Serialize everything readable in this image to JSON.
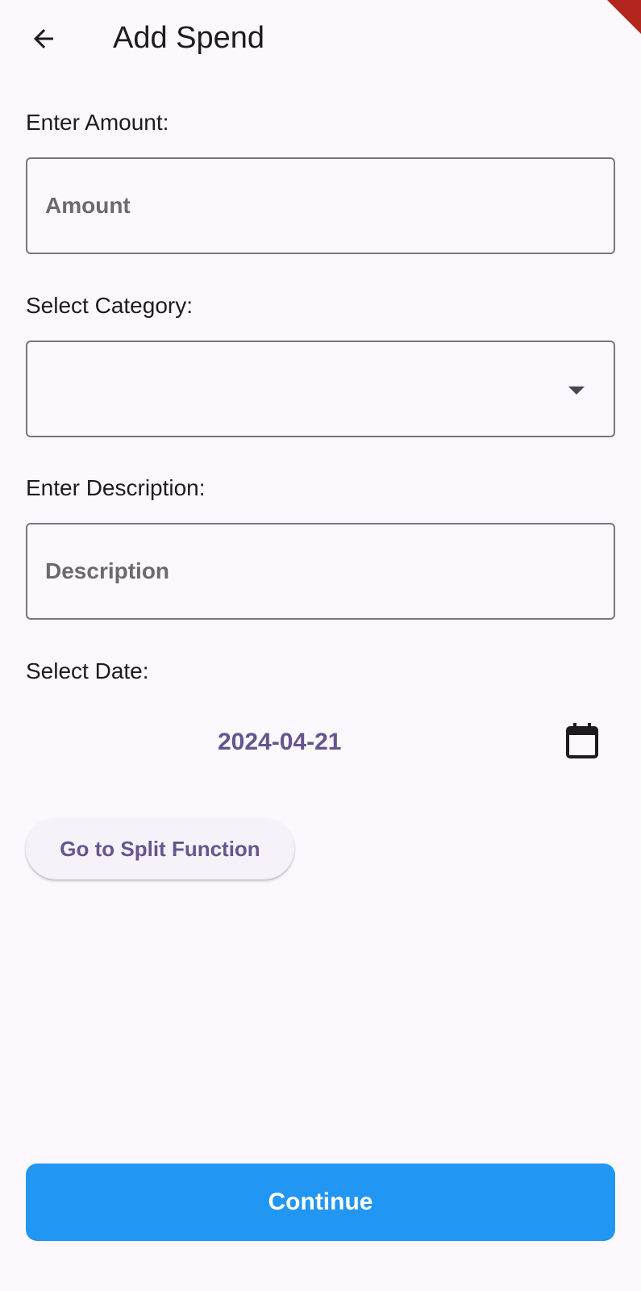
{
  "app_bar": {
    "title": "Add Spend",
    "back_icon": "arrow-back-icon"
  },
  "amount": {
    "label": "Enter Amount:",
    "placeholder": "Amount",
    "value": ""
  },
  "category": {
    "label": "Select Category:",
    "selected": "",
    "arrow_icon": "arrow-drop-down-icon"
  },
  "description": {
    "label": "Enter Description:",
    "placeholder": "Description",
    "value": ""
  },
  "date": {
    "label": "Select Date:",
    "value": "2024-04-21",
    "calendar_icon": "calendar-icon"
  },
  "split_button": {
    "label": "Go to Split Function"
  },
  "continue_button": {
    "label": "Continue"
  },
  "colors": {
    "background": "#fdf8fd",
    "primary_text": "#1d1b20",
    "accent_purple": "#65558f",
    "continue_blue": "#2196f3",
    "field_border": "#7a757f",
    "debug_ribbon": "#b3261e"
  }
}
